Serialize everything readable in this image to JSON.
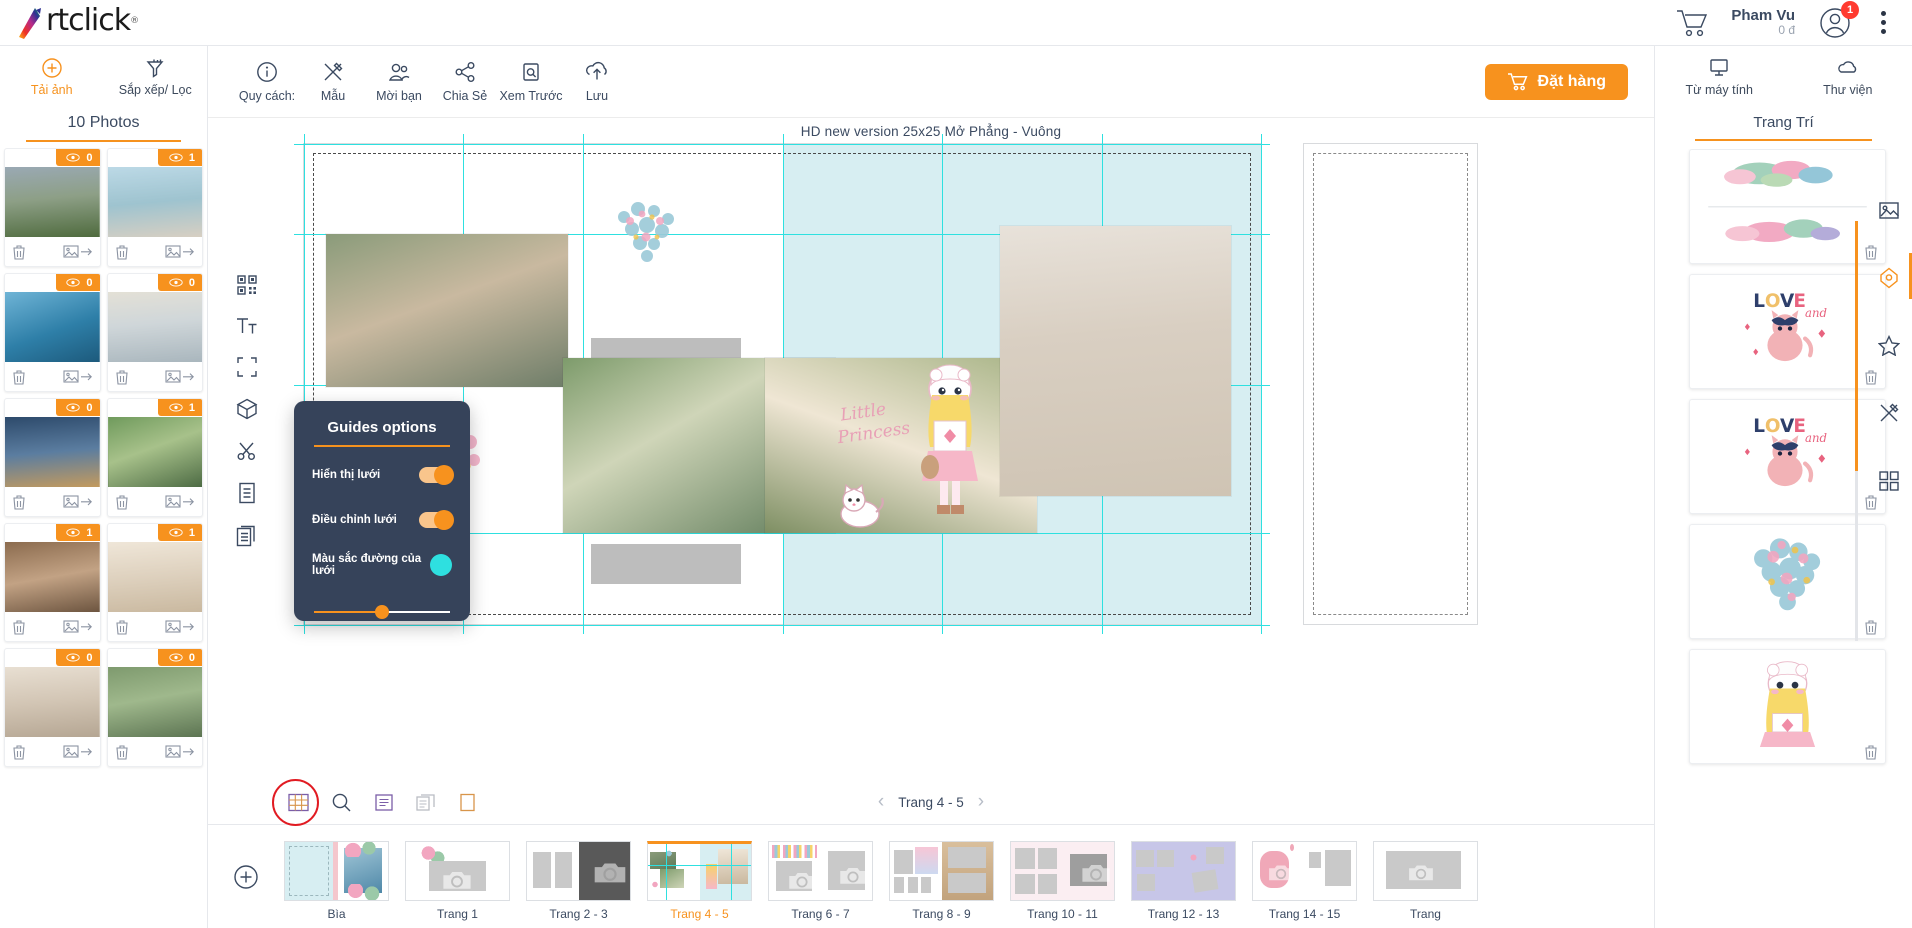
{
  "app": {
    "brand": "rtclick",
    "brand_reg": "®"
  },
  "topbar": {
    "cart_icon": "cart-icon",
    "user_name": "Pham Vu",
    "user_balance": "0 đ",
    "notification_count": "1",
    "menu_icon": "kebab-menu-icon"
  },
  "left_panel": {
    "tools": [
      {
        "label": "Tải ảnh",
        "icon": "plus-circle-icon",
        "active": true
      },
      {
        "label": "Sắp xếp/ Lọc",
        "icon": "filter-icon",
        "active": false
      }
    ],
    "title": "10 Photos",
    "photos": [
      {
        "uses": "0",
        "alt": "boy-kicking-by-lake"
      },
      {
        "uses": "1",
        "alt": "girl-on-balcony"
      },
      {
        "uses": "0",
        "alt": "boat-trip-life-vests"
      },
      {
        "uses": "0",
        "alt": "two-kids-in-corridor"
      },
      {
        "uses": "0",
        "alt": "girl-in-front-of-resort"
      },
      {
        "uses": "1",
        "alt": "girl-smiling-with-headband"
      },
      {
        "uses": "1",
        "alt": "family-on-wooden-bridge"
      },
      {
        "uses": "1",
        "alt": "girl-lying-in-hammock"
      },
      {
        "uses": "0",
        "alt": "room-interior-with-bed"
      },
      {
        "uses": "0",
        "alt": "girl-by-the-lake"
      }
    ],
    "row_icons": {
      "delete": "trash-icon",
      "move": "move-image-icon"
    }
  },
  "center_toolbar": {
    "tools": [
      {
        "label": "Quy cách:",
        "icon": "info-icon"
      },
      {
        "label": "Mẫu",
        "icon": "template-icon"
      },
      {
        "label": "Mời bạn",
        "icon": "invite-friend-icon"
      },
      {
        "label": "Chia Sẻ",
        "icon": "share-icon"
      },
      {
        "label": "Xem Trước",
        "icon": "preview-icon"
      },
      {
        "label": "Lưu",
        "icon": "save-upload-icon"
      }
    ],
    "order_button": "Đặt hàng",
    "order_icon": "cart-icon"
  },
  "canvas": {
    "header": "HD new version   25x25 Mở Phẳng - Vuông",
    "rail_icons": [
      "qr-code-icon",
      "text-icon",
      "crop-icon",
      "box-3d-icon",
      "scissors-icon",
      "page-icon",
      "duplicate-icon"
    ]
  },
  "guides_panel": {
    "title": "Guides options",
    "rows": [
      {
        "label": "Hiển thị lưới",
        "control": "toggle",
        "value": "on"
      },
      {
        "label": "Điều chỉnh lưới",
        "control": "toggle",
        "value": "on"
      },
      {
        "label": "Màu sắc đường của lưới",
        "control": "color",
        "value": "#2ee0e0"
      }
    ],
    "slider_value": "48"
  },
  "stage_bar": {
    "tools": [
      {
        "name": "grid-icon",
        "highlighted": true
      },
      {
        "name": "zoom-icon",
        "highlighted": false
      },
      {
        "name": "single-page-icon",
        "highlighted": false
      },
      {
        "name": "spread-page-icon",
        "highlighted": false
      },
      {
        "name": "blank-page-icon",
        "highlighted": false
      }
    ],
    "pager_prev": "‹",
    "pager_label": "Trang 4 - 5",
    "pager_next": "›"
  },
  "filmstrip": {
    "add_icon": "add-page-icon",
    "pages": [
      {
        "label": "Bìa",
        "selected": false
      },
      {
        "label": "Trang 1",
        "selected": false
      },
      {
        "label": "Trang 2 - 3",
        "selected": false
      },
      {
        "label": "Trang 4 - 5",
        "selected": true
      },
      {
        "label": "Trang 6 - 7",
        "selected": false
      },
      {
        "label": "Trang 8 - 9",
        "selected": false
      },
      {
        "label": "Trang 10 - 11",
        "selected": false
      },
      {
        "label": "Trang 12 - 13",
        "selected": false
      },
      {
        "label": "Trang 14 - 15",
        "selected": false
      },
      {
        "label": "Trang",
        "selected": false
      }
    ]
  },
  "right_panel": {
    "tools": [
      {
        "label": "Từ máy tính",
        "icon": "monitor-icon"
      },
      {
        "label": "Thư viện",
        "icon": "cloud-icon"
      }
    ],
    "title": "Trang Trí",
    "items": [
      {
        "alt": "floral-frame-decoration",
        "delete_icon": "trash-icon"
      },
      {
        "alt": "love-and-cat-sticker",
        "delete_icon": "trash-icon"
      },
      {
        "alt": "love-and-cat-sticker-2",
        "delete_icon": "trash-icon"
      },
      {
        "alt": "floral-heart-decoration",
        "delete_icon": "trash-icon"
      },
      {
        "alt": "little-princess-doll-sticker",
        "delete_icon": "trash-icon"
      }
    ],
    "rail": [
      {
        "icon": "image-icon",
        "active": false
      },
      {
        "icon": "sticker-icon",
        "active": true
      },
      {
        "icon": "star-icon",
        "active": false
      },
      {
        "icon": "template-icon",
        "active": false
      },
      {
        "icon": "layout-grid-icon",
        "active": false
      }
    ]
  },
  "colors": {
    "accent": "#f7921e",
    "guide": "#2ee0e0",
    "panel_bg": "#36435a",
    "text": "#3b4a61",
    "page_tint": "#d7eef2",
    "highlight_ring": "#e11b22"
  }
}
